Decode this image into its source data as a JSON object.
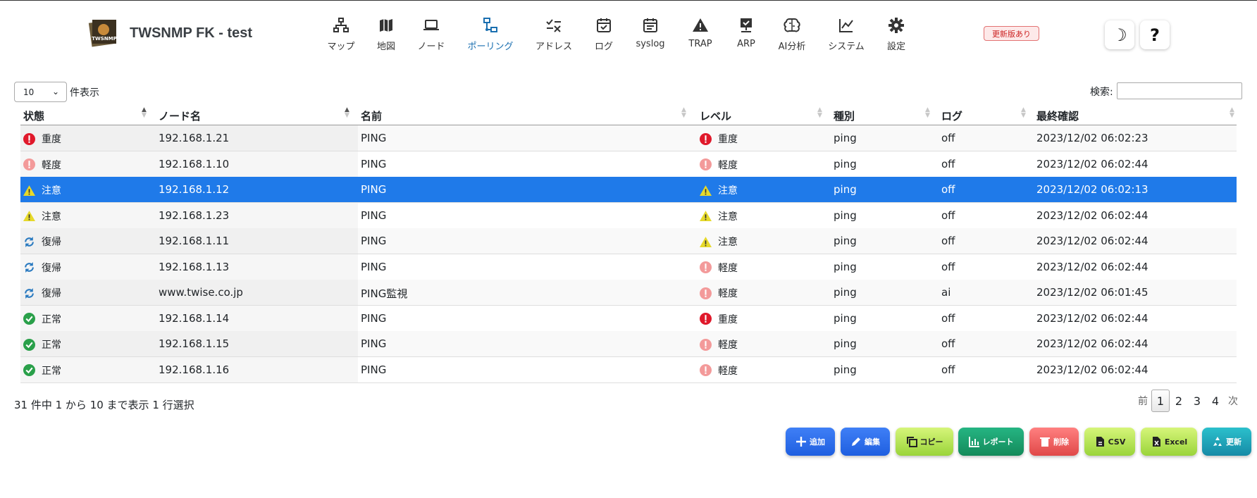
{
  "app": {
    "title": "TWSNMP FK - test",
    "logo_text": "TWSNMP"
  },
  "nav": [
    {
      "label": "マップ",
      "icon": "map-network-icon"
    },
    {
      "label": "地図",
      "icon": "geo-map-icon"
    },
    {
      "label": "ノード",
      "icon": "laptop-icon"
    },
    {
      "label": "ポーリング",
      "icon": "polling-icon",
      "active": true
    },
    {
      "label": "アドレス",
      "icon": "address-check-icon"
    },
    {
      "label": "ログ",
      "icon": "calendar-check-icon"
    },
    {
      "label": "syslog",
      "icon": "calendar-icon"
    },
    {
      "label": "TRAP",
      "icon": "warning-icon"
    },
    {
      "label": "ARP",
      "icon": "monitor-check-icon"
    },
    {
      "label": "AI分析",
      "icon": "brain-icon"
    },
    {
      "label": "システム",
      "icon": "chart-line-icon"
    },
    {
      "label": "設定",
      "icon": "gear-icon"
    }
  ],
  "update_badge": "更新版あり",
  "theme_toggle_icon": "☽",
  "help_icon": "?",
  "table": {
    "page_length": "10",
    "page_length_label": "件表示",
    "search_label": "検索:",
    "search_value": "",
    "columns": [
      "状態",
      "ノード名",
      "名前",
      "レベル",
      "種別",
      "ログ",
      "最終確認"
    ],
    "rows": [
      {
        "state": "重度",
        "state_icon": "high",
        "node": "192.168.1.21",
        "name": "PING",
        "level": "重度",
        "level_icon": "high",
        "type": "ping",
        "log": "off",
        "last": "2023/12/02 06:02:23"
      },
      {
        "state": "軽度",
        "state_icon": "low",
        "node": "192.168.1.10",
        "name": "PING",
        "level": "軽度",
        "level_icon": "low",
        "type": "ping",
        "log": "off",
        "last": "2023/12/02 06:02:44"
      },
      {
        "state": "注意",
        "state_icon": "warn",
        "node": "192.168.1.12",
        "name": "PING",
        "level": "注意",
        "level_icon": "warn",
        "type": "ping",
        "log": "off",
        "last": "2023/12/02 06:02:13",
        "selected": true
      },
      {
        "state": "注意",
        "state_icon": "warn",
        "node": "192.168.1.23",
        "name": "PING",
        "level": "注意",
        "level_icon": "warn",
        "type": "ping",
        "log": "off",
        "last": "2023/12/02 06:02:44"
      },
      {
        "state": "復帰",
        "state_icon": "repair",
        "node": "192.168.1.11",
        "name": "PING",
        "level": "注意",
        "level_icon": "warn",
        "type": "ping",
        "log": "off",
        "last": "2023/12/02 06:02:44"
      },
      {
        "state": "復帰",
        "state_icon": "repair",
        "node": "192.168.1.13",
        "name": "PING",
        "level": "軽度",
        "level_icon": "low",
        "type": "ping",
        "log": "off",
        "last": "2023/12/02 06:02:44"
      },
      {
        "state": "復帰",
        "state_icon": "repair",
        "node": "www.twise.co.jp",
        "name": "PING監視",
        "level": "軽度",
        "level_icon": "low",
        "type": "ping",
        "log": "ai",
        "last": "2023/12/02 06:01:45"
      },
      {
        "state": "正常",
        "state_icon": "normal",
        "node": "192.168.1.14",
        "name": "PING",
        "level": "重度",
        "level_icon": "high",
        "type": "ping",
        "log": "off",
        "last": "2023/12/02 06:02:44"
      },
      {
        "state": "正常",
        "state_icon": "normal",
        "node": "192.168.1.15",
        "name": "PING",
        "level": "軽度",
        "level_icon": "low",
        "type": "ping",
        "log": "off",
        "last": "2023/12/02 06:02:44"
      },
      {
        "state": "正常",
        "state_icon": "normal",
        "node": "192.168.1.16",
        "name": "PING",
        "level": "軽度",
        "level_icon": "low",
        "type": "ping",
        "log": "off",
        "last": "2023/12/02 06:02:44"
      }
    ],
    "info": "31 件中 1 から 10 まで表示 1 行選択",
    "pager": {
      "prev": "前",
      "pages": [
        "1",
        "2",
        "3",
        "4"
      ],
      "current": "1",
      "next": "次"
    }
  },
  "actions": [
    {
      "label": "追加",
      "icon": "plus-icon",
      "color": "#2b6ff0"
    },
    {
      "label": "編集",
      "icon": "pencil-icon",
      "color": "#2b6ff0"
    },
    {
      "label": "コピー",
      "icon": "copy-icon",
      "color": "#a8e04a"
    },
    {
      "label": "レポート",
      "icon": "bar-chart-icon",
      "color": "#1aa36b"
    },
    {
      "label": "削除",
      "icon": "trash-icon",
      "color": "#f06060"
    },
    {
      "label": "CSV",
      "icon": "csv-file-icon",
      "color": "#a8e04a"
    },
    {
      "label": "Excel",
      "icon": "excel-file-icon",
      "color": "#a8e04a"
    },
    {
      "label": "更新",
      "icon": "recycle-icon",
      "color": "#1aa0b8"
    }
  ],
  "colors": {
    "accent": "#1a6fb0",
    "selected_row": "#1f7ae9",
    "state_high": "#e0192b",
    "state_low": "#f39a9a",
    "state_warn": "#e6d92a",
    "state_repair": "#2a7ac0",
    "state_normal": "#2aa04a"
  }
}
